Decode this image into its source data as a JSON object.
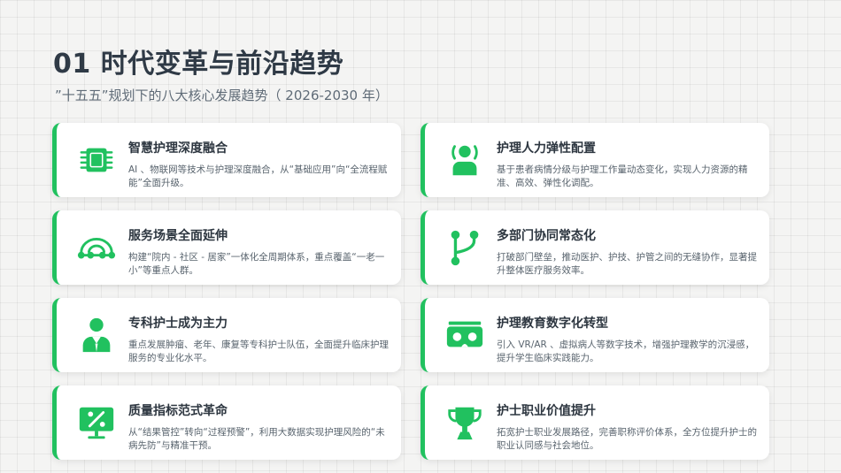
{
  "header": {
    "title": "01  时代变革与前沿趋势",
    "subtitle": "”十五五”规划下的八大核心发展趋势（ 2026-2030 年）"
  },
  "accent_color": "#21c15f",
  "cards": [
    {
      "icon": "chip-icon",
      "title": "智慧护理深度融合",
      "desc": "AI 、物联网等技术与护理深度融合，从“基础应用”向“全流程赋能”全面升级。"
    },
    {
      "icon": "staff-icon",
      "title": "护理人力弹性配置",
      "desc": "基于患者病情分级与护理工作量动态变化，实现人力资源的精准、高效、弹性化调配。"
    },
    {
      "icon": "network-arc-icon",
      "title": "服务场景全面延伸",
      "desc": "构建“院内 - 社区 - 居家”一体化全周期体系，重点覆盖“一老一小”等重点人群。"
    },
    {
      "icon": "branch-icon",
      "title": "多部门协同常态化",
      "desc": "打破部门壁垒，推动医护、护技、护管之间的无缝协作，显著提升整体医疗服务效率。"
    },
    {
      "icon": "nurse-icon",
      "title": "专科护士成为主力",
      "desc": "重点发展肿瘤、老年、康复等专科护士队伍，全面提升临床护理服务的专业化水平。"
    },
    {
      "icon": "vr-headset-icon",
      "title": "护理教育数字化转型",
      "desc": "引入 VR/AR 、虚拟病人等数字技术，增强护理教学的沉浸感，提升学生临床实践能力。"
    },
    {
      "icon": "percent-screen-icon",
      "title": "质量指标范式革命",
      "desc": "从“结果管控”转向“过程预警”，利用大数据实现护理风险的“未病先防”与精准干预。"
    },
    {
      "icon": "trophy-icon",
      "title": "护士职业价值提升",
      "desc": "拓宽护士职业发展路径，完善职称评价体系，全方位提升护士的职业认同感与社会地位。"
    }
  ]
}
